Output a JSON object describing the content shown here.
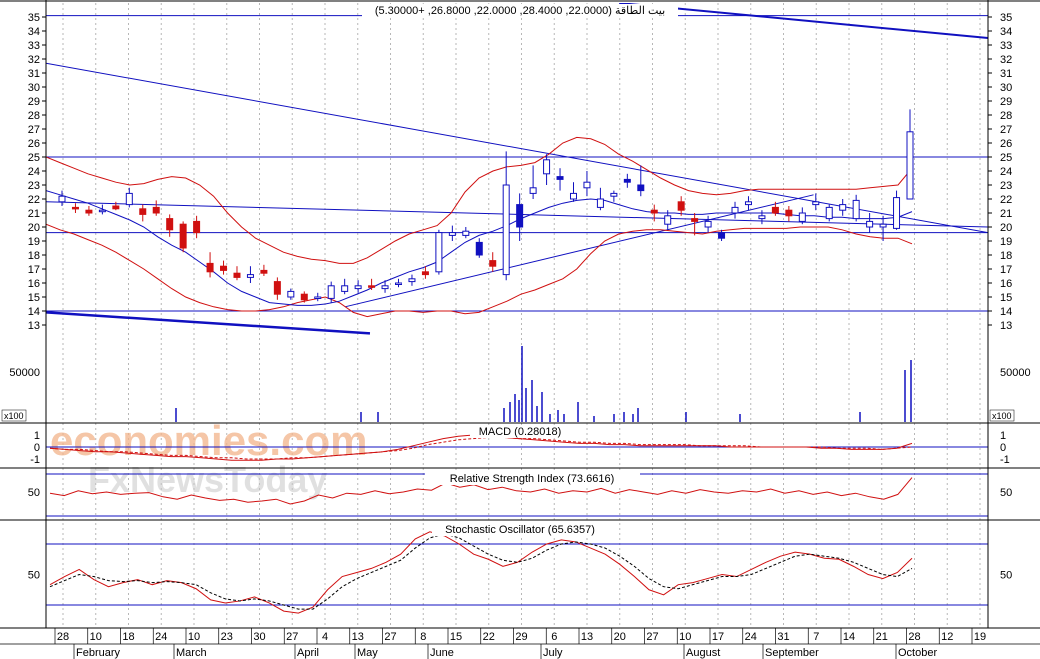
{
  "chart_data": [
    {
      "type": "candlestick",
      "panel": "price",
      "title": "بيت الطاقة (22.0000, 28.4000, 22.0000, 26.8000, +5.30000)",
      "ylim": [
        12.3,
        36.2
      ],
      "yticks": [
        13,
        14,
        15,
        16,
        17,
        18,
        19,
        20,
        21,
        22,
        23,
        24,
        25,
        26,
        27,
        28,
        29,
        30,
        31,
        32,
        33,
        34,
        35
      ],
      "horizontal_lines": [
        25,
        19.6,
        14,
        35.1
      ],
      "trend_lines": [
        {
          "x1": 0,
          "y1": 21.8,
          "x2": 189,
          "y2": 20.0
        },
        {
          "x1": 0,
          "y1": 31.7,
          "x2": 189,
          "y2": 19.6
        },
        {
          "x1": 60,
          "y1": 14.3,
          "x2": 154,
          "y2": 22.3
        },
        {
          "x1": 0,
          "y1": 13.9,
          "x2": 65,
          "y2": 12.4
        },
        {
          "x1": 115,
          "y1": 36.0,
          "x2": 189,
          "y2": 33.5
        }
      ],
      "bollinger_upper": [
        25.0,
        24.6,
        24.2,
        23.8,
        23.5,
        23.2,
        23.0,
        23.1,
        23.4,
        23.6,
        23.5,
        23.0,
        22.2,
        21.0,
        20.0,
        19.2,
        18.7,
        18.2,
        17.9,
        17.7,
        17.6,
        17.4,
        17.4,
        17.8,
        18.4,
        19.0,
        19.5,
        19.8,
        20.1,
        21.0,
        22.5,
        23.5,
        24.0,
        24.3,
        24.4,
        24.6,
        25.2,
        26.0,
        26.4,
        26.3,
        25.9,
        25.2,
        24.7,
        24.1,
        23.5,
        23.0,
        22.6,
        22.4,
        22.3,
        22.4,
        22.6,
        22.7,
        22.7,
        22.7,
        22.7,
        22.7,
        22.7,
        22.7,
        22.7,
        22.8,
        22.9,
        23.0,
        24.2
      ],
      "bollinger_lower": [
        20.2,
        19.8,
        19.5,
        19.1,
        18.7,
        18.2,
        17.6,
        17.0,
        16.3,
        15.6,
        15.0,
        14.6,
        14.3,
        14.1,
        14.0,
        14.0,
        14.1,
        14.3,
        14.6,
        14.8,
        15.0,
        14.6,
        13.9,
        13.6,
        13.8,
        14.0,
        14.0,
        13.9,
        14.0,
        14.0,
        13.8,
        13.9,
        14.3,
        14.7,
        15.2,
        15.5,
        15.9,
        16.3,
        17.0,
        18.1,
        19.0,
        19.5,
        19.7,
        19.8,
        19.8,
        19.7,
        19.6,
        19.5,
        19.7,
        19.8,
        19.9,
        19.9,
        19.9,
        19.9,
        20.0,
        20.0,
        20.0,
        19.8,
        19.5,
        19.3,
        19.2,
        19.2,
        18.8
      ],
      "bollinger_mid": [
        22.6,
        22.3,
        22.0,
        21.7,
        21.3,
        20.9,
        20.5,
        20.0,
        19.3,
        18.7,
        18.2,
        17.5,
        16.8,
        16.0,
        15.4,
        15.0,
        14.6,
        14.5,
        14.4,
        14.4,
        14.5,
        14.7,
        15.1,
        15.5,
        16.0,
        16.4,
        16.8,
        17.1,
        17.5,
        18.2,
        18.9,
        19.4,
        19.7,
        20.1,
        20.6,
        21.0,
        21.4,
        21.7,
        21.9,
        22.0,
        21.9,
        21.6,
        21.3,
        21.1,
        21.0,
        21.0,
        20.9,
        20.9,
        21.0,
        21.0,
        21.0,
        21.0,
        21.0,
        20.9,
        20.8,
        20.8,
        20.7,
        20.7,
        20.6,
        20.6,
        20.6,
        20.7,
        21.1
      ],
      "candles": [
        [
          21.8,
          22.6,
          21.5,
          22.2,
          "w"
        ],
        [
          21.4,
          21.7,
          21.0,
          21.3,
          "r"
        ],
        [
          21.2,
          21.5,
          20.8,
          21.0,
          "r"
        ],
        [
          21.1,
          21.6,
          20.9,
          21.2,
          "w"
        ],
        [
          21.5,
          21.8,
          21.2,
          21.3,
          "r"
        ],
        [
          21.6,
          22.8,
          21.4,
          22.4,
          "w"
        ],
        [
          21.3,
          21.6,
          20.4,
          20.9,
          "r"
        ],
        [
          21.4,
          21.9,
          20.8,
          21.0,
          "r"
        ],
        [
          20.6,
          20.9,
          19.3,
          19.8,
          "r"
        ],
        [
          20.2,
          20.4,
          18.2,
          18.5,
          "r"
        ],
        [
          20.4,
          20.8,
          19.2,
          19.6,
          "r"
        ],
        [
          17.4,
          18.2,
          16.4,
          16.8,
          "r"
        ],
        [
          17.2,
          17.6,
          16.6,
          16.9,
          "r"
        ],
        [
          16.7,
          17.2,
          16.2,
          16.4,
          "r"
        ],
        [
          16.6,
          17.2,
          16.0,
          16.4,
          "w"
        ],
        [
          16.9,
          17.3,
          16.5,
          16.7,
          "r"
        ],
        [
          16.1,
          16.4,
          14.8,
          15.2,
          "r"
        ],
        [
          15.4,
          15.6,
          14.8,
          15.0,
          "w"
        ],
        [
          15.2,
          15.4,
          14.6,
          14.8,
          "r"
        ],
        [
          15.0,
          15.3,
          14.7,
          14.9,
          "w"
        ],
        [
          14.9,
          16.1,
          14.6,
          15.8,
          "w"
        ],
        [
          15.4,
          16.3,
          15.2,
          15.8,
          "w"
        ],
        [
          15.6,
          16.2,
          15.3,
          15.8,
          "w"
        ],
        [
          15.8,
          16.3,
          15.5,
          15.7,
          "r"
        ],
        [
          15.8,
          16.2,
          15.3,
          15.6,
          "w"
        ],
        [
          16.0,
          16.3,
          15.7,
          16.0,
          "w"
        ],
        [
          16.3,
          16.6,
          15.8,
          16.1,
          "w"
        ],
        [
          16.8,
          17.2,
          16.3,
          16.6,
          "r"
        ],
        [
          16.8,
          19.8,
          16.6,
          19.6,
          "w"
        ],
        [
          19.4,
          20.1,
          19.0,
          19.6,
          "w"
        ],
        [
          19.7,
          20.0,
          19.2,
          19.4,
          "w"
        ],
        [
          18.9,
          19.2,
          17.8,
          18.0,
          "b"
        ],
        [
          17.6,
          18.2,
          16.8,
          17.2,
          "r"
        ],
        [
          16.6,
          25.4,
          16.2,
          23.0,
          "w"
        ],
        [
          21.6,
          22.4,
          19.0,
          20.0,
          "b"
        ],
        [
          22.8,
          24.4,
          22.0,
          22.4,
          "w"
        ],
        [
          23.8,
          25.2,
          23.0,
          24.8,
          "w"
        ],
        [
          23.4,
          24.2,
          22.6,
          23.6,
          "b"
        ],
        [
          22.4,
          23.2,
          21.8,
          22.0,
          "w"
        ],
        [
          22.8,
          24.0,
          22.2,
          23.2,
          "w"
        ],
        [
          22.0,
          22.8,
          21.2,
          21.4,
          "w"
        ],
        [
          22.2,
          22.6,
          21.8,
          22.4,
          "w"
        ],
        [
          23.4,
          23.8,
          22.8,
          23.2,
          "b"
        ],
        [
          22.6,
          24.4,
          22.2,
          23.0,
          "b"
        ],
        [
          21.2,
          21.6,
          20.4,
          21.0,
          "r"
        ],
        [
          20.8,
          21.2,
          19.8,
          20.2,
          "w"
        ],
        [
          21.2,
          22.2,
          20.8,
          21.8,
          "r"
        ],
        [
          20.6,
          21.0,
          19.4,
          20.4,
          "r"
        ],
        [
          20.4,
          20.8,
          19.6,
          20.0,
          "w"
        ],
        [
          19.6,
          19.8,
          19.0,
          19.2,
          "b"
        ],
        [
          21.4,
          21.8,
          20.6,
          21.0,
          "w"
        ],
        [
          21.8,
          22.2,
          21.2,
          21.6,
          "w"
        ],
        [
          20.8,
          21.2,
          20.2,
          20.6,
          "w"
        ],
        [
          21.4,
          21.8,
          20.8,
          21.0,
          "r"
        ],
        [
          21.2,
          21.5,
          20.4,
          20.8,
          "r"
        ],
        [
          21.0,
          21.4,
          20.2,
          20.4,
          "w"
        ],
        [
          21.6,
          22.4,
          21.2,
          21.8,
          "w"
        ],
        [
          20.6,
          21.6,
          20.4,
          21.4,
          "w"
        ],
        [
          21.2,
          22.0,
          20.8,
          21.6,
          "w"
        ],
        [
          20.6,
          22.3,
          20.4,
          21.9,
          "w"
        ],
        [
          20.0,
          21.0,
          19.6,
          20.4,
          "w"
        ],
        [
          20.2,
          20.8,
          19.0,
          20.0,
          "w"
        ],
        [
          19.9,
          22.6,
          19.8,
          22.1,
          "w"
        ],
        [
          22.0,
          28.4,
          22.0,
          26.8,
          "w"
        ]
      ],
      "volume_label": "50000",
      "volume_unit": "x100",
      "volume": [
        0,
        0,
        0,
        0,
        0,
        0,
        0,
        0,
        0,
        0,
        0,
        0,
        0,
        0,
        0,
        0,
        0,
        0,
        0,
        0,
        0,
        0,
        0,
        0,
        0,
        0,
        0,
        0,
        0,
        0,
        0,
        0,
        0,
        0,
        0,
        0,
        0,
        0,
        0,
        0,
        0,
        0,
        0,
        0,
        0,
        0,
        0,
        0,
        0,
        0,
        0,
        0,
        0,
        0,
        0,
        0,
        0,
        0,
        0,
        0,
        0,
        0,
        0,
        0,
        0,
        0,
        0,
        0,
        0,
        0,
        0,
        0,
        0,
        0,
        0,
        0,
        0,
        0,
        0,
        0,
        0,
        0,
        0,
        0,
        0,
        0,
        0,
        0,
        0,
        0,
        0,
        0,
        0,
        0,
        0,
        0,
        0,
        0,
        0,
        0,
        0,
        0,
        0,
        0,
        0,
        0,
        0,
        0,
        0,
        0,
        0,
        0,
        0,
        0,
        0,
        0,
        0,
        0,
        0,
        0,
        0,
        0,
        0,
        0,
        0,
        0,
        0,
        0,
        0,
        0,
        0,
        0,
        0,
        0,
        0,
        0,
        0,
        0,
        0,
        0,
        0,
        0,
        0,
        0,
        0,
        0,
        0,
        0,
        0,
        0,
        0,
        0,
        0,
        0,
        0,
        0,
        0,
        0,
        0,
        0,
        0,
        0,
        0,
        0,
        0,
        0,
        0,
        0,
        0,
        0,
        0,
        0,
        0,
        0,
        0,
        0,
        0,
        0,
        0,
        0,
        0,
        0,
        0,
        0,
        0,
        0,
        0,
        0,
        0,
        0
      ]
    },
    {
      "type": "line",
      "panel": "macd",
      "title": "MACD (0.28018)",
      "yticks": [
        "1",
        "0",
        "-1"
      ],
      "macd": [
        -0.1,
        -0.2,
        -0.3,
        -0.4,
        -0.4,
        -0.5,
        -0.6,
        -0.7,
        -0.8,
        -0.8,
        -0.9,
        -1.0,
        -1.1,
        -1.1,
        -1.1,
        -1.0,
        -1.0,
        -0.9,
        -0.8,
        -0.7,
        -0.6,
        -0.5,
        -0.4,
        -0.2,
        0.1,
        0.4,
        0.7,
        0.9,
        1.0,
        0.9,
        0.8,
        0.7,
        0.6,
        0.5,
        0.4,
        0.3,
        0.3,
        0.2,
        0.2,
        0.1,
        0.1,
        0.1,
        0.1,
        0.1,
        0.1,
        0.0,
        0.0,
        0.0,
        0.0,
        0.0,
        0.0,
        -0.1,
        -0.1,
        -0.2,
        -0.2,
        -0.2,
        -0.1,
        0.3
      ],
      "signal": [
        -0.1,
        -0.2,
        -0.2,
        -0.3,
        -0.4,
        -0.4,
        -0.5,
        -0.6,
        -0.7,
        -0.7,
        -0.8,
        -0.9,
        -0.9,
        -1.0,
        -1.0,
        -1.0,
        -0.9,
        -0.9,
        -0.8,
        -0.7,
        -0.6,
        -0.5,
        -0.4,
        -0.3,
        -0.1,
        0.2,
        0.4,
        0.6,
        0.7,
        0.8,
        0.8,
        0.7,
        0.7,
        0.6,
        0.5,
        0.4,
        0.4,
        0.3,
        0.3,
        0.2,
        0.2,
        0.2,
        0.2,
        0.1,
        0.1,
        0.1,
        0.1,
        0.0,
        0.0,
        0.0,
        0.0,
        0.0,
        -0.1,
        -0.1,
        -0.1,
        -0.2,
        -0.1,
        0.0
      ]
    },
    {
      "type": "line",
      "panel": "rsi",
      "title": "Relative Strength Index (73.6616)",
      "yticks": [
        "50"
      ],
      "rsi": [
        48,
        44,
        52,
        47,
        50,
        46,
        48,
        49,
        42,
        38,
        45,
        40,
        36,
        38,
        33,
        35,
        38,
        30,
        35,
        45,
        40,
        48,
        46,
        52,
        47,
        50,
        55,
        53,
        65,
        58,
        62,
        54,
        58,
        52,
        50,
        55,
        48,
        52,
        50,
        56,
        48,
        54,
        50,
        46,
        52,
        48,
        54,
        50,
        48,
        52,
        50,
        55,
        48,
        52,
        46,
        50,
        44,
        48,
        42,
        38,
        46,
        74
      ]
    },
    {
      "type": "line",
      "panel": "stochastic",
      "title": "Stochastic Oscillator (65.6357)",
      "yticks": [
        "50"
      ],
      "k": [
        40,
        48,
        55,
        45,
        38,
        42,
        45,
        40,
        44,
        42,
        36,
        25,
        22,
        24,
        28,
        22,
        14,
        12,
        18,
        35,
        48,
        52,
        56,
        62,
        70,
        85,
        92,
        88,
        80,
        70,
        65,
        58,
        62,
        72,
        80,
        84,
        82,
        76,
        70,
        60,
        48,
        35,
        30,
        40,
        42,
        46,
        50,
        48,
        55,
        62,
        68,
        72,
        70,
        66,
        65,
        58,
        50,
        46,
        52,
        66
      ],
      "d": [
        38,
        44,
        50,
        48,
        44,
        43,
        44,
        42,
        43,
        42,
        40,
        32,
        26,
        24,
        26,
        24,
        20,
        16,
        16,
        26,
        38,
        46,
        52,
        58,
        64,
        76,
        86,
        90,
        86,
        78,
        70,
        64,
        62,
        66,
        74,
        80,
        82,
        80,
        76,
        68,
        58,
        46,
        38,
        36,
        40,
        44,
        48,
        48,
        50,
        56,
        62,
        68,
        70,
        68,
        66,
        62,
        56,
        50,
        48,
        56
      ]
    }
  ],
  "x_axis": {
    "day_ticks": [
      "28",
      "10",
      "18",
      "24",
      "10",
      "23",
      "30",
      "27",
      "4",
      "13",
      "27",
      "8",
      "15",
      "22",
      "29",
      "6",
      "13",
      "20",
      "27",
      "10",
      "17",
      "24",
      "31",
      "7",
      "14",
      "21",
      "28",
      "12",
      "19"
    ],
    "months": [
      "February",
      "March",
      "April",
      "May",
      "June",
      "July",
      "August",
      "September",
      "October"
    ],
    "right_ticks": [
      "35",
      "34",
      "33",
      "32",
      "31",
      "30",
      "29",
      "28",
      "27",
      "26",
      "25",
      "24",
      "23",
      "22",
      "21",
      "20",
      "19",
      "18",
      "17",
      "16",
      "15",
      "14",
      "13"
    ],
    "unit_label": "x100"
  },
  "watermark": {
    "line1": "economies.com",
    "line2": "FxNewsToday"
  },
  "colors": {
    "grid": "#b7b7b7",
    "blue": "#1010c0",
    "red": "#d01010",
    "axis": "#000000",
    "watermark": "#e8a070"
  }
}
